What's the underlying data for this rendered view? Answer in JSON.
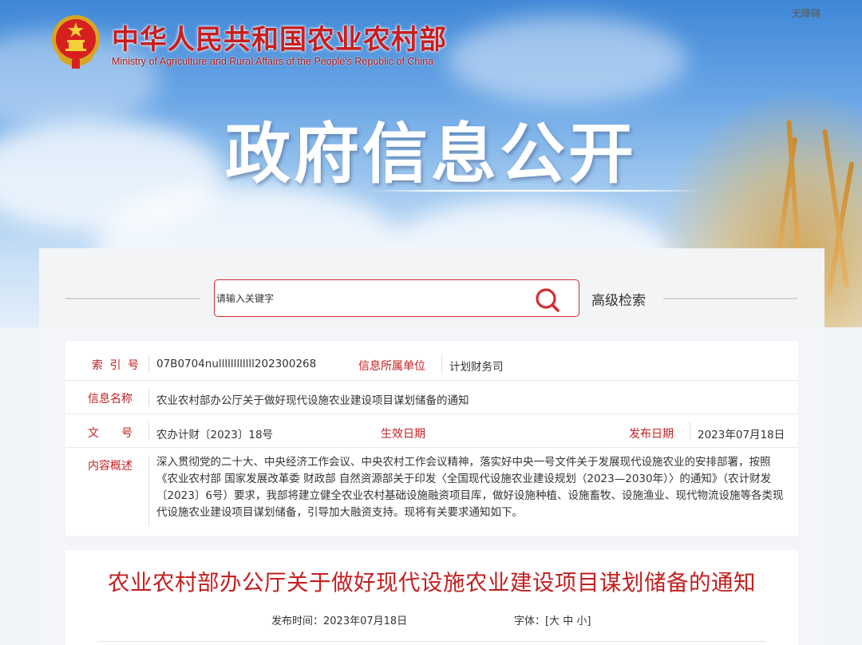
{
  "header": {
    "accessibility_label": "无障碍",
    "ministry_name_cn": "中华人民共和国农业农村部",
    "ministry_name_en": "Ministry of Agriculture and Rural Affairs of the People's Republic of China",
    "banner_title": "政府信息公开"
  },
  "search": {
    "placeholder": "请输入关键字",
    "advanced_label": "高级检索"
  },
  "info": {
    "index_label": "索 引 号",
    "index_value": "07B0704nullllllllllll202300268",
    "unit_label": "信息所属单位",
    "unit_value": "计划财务司",
    "name_label": "信息名称",
    "name_value": "农业农村部办公厅关于做好现代设施农业建设项目谋划储备的通知",
    "doc_label_1": "文",
    "doc_label_2": "号",
    "doc_value": "农办计财〔2023〕18号",
    "effective_label": "生效日期",
    "publish_label": "发布日期",
    "publish_value": "2023年07月18日",
    "summary_label": "内容概述",
    "summary_value": "深入贯彻党的二十大、中央经济工作会议、中央农村工作会议精神，落实好中央一号文件关于发展现代设施农业的安排部署，按照《农业农村部 国家发展改革委 财政部 自然资源部关于印发〈全国现代设施农业建设规划（2023—2030年）〉的通知》（农计财发〔2023〕6号）要求，我部将建立健全农业农村基础设施融资项目库，做好设施种植、设施畜牧、设施渔业、现代物流设施等各类现代设施农业建设项目谋划储备，引导加大融资支持。现将有关要求通知如下。"
  },
  "article": {
    "title": "农业农村部办公厅关于做好现代设施农业建设项目谋划储备的通知",
    "publish_time_label": "发布时间：",
    "publish_time_value": "2023年07月18日",
    "font_label": "字体：",
    "font_open": "[",
    "font_large": "大",
    "font_medium": "中",
    "font_small": "小",
    "font_close": "]"
  },
  "colors": {
    "accent_red": "#c21f1f",
    "search_border": "#d62c2c",
    "banner_sky": "#6aa6e6"
  },
  "icons": [
    "national-emblem-icon",
    "search-icon"
  ]
}
